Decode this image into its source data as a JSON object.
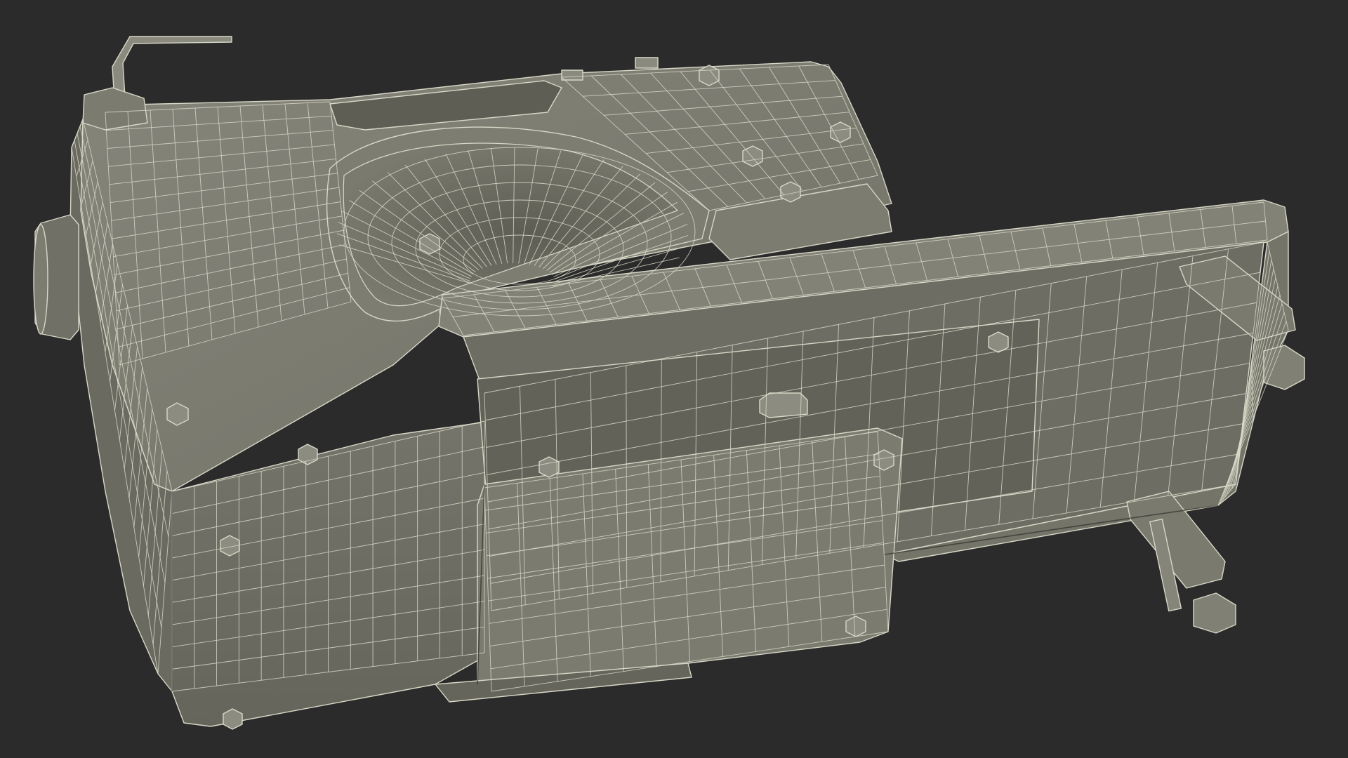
{
  "scene": {
    "background_color": "#2b2b2b",
    "model_fill_color": "#77776c",
    "model_shade_color": "#5f5f55",
    "model_light_color": "#8a8a7e",
    "wire_color": "#d9d9c9",
    "render_style": "wireframe-over-shaded"
  }
}
